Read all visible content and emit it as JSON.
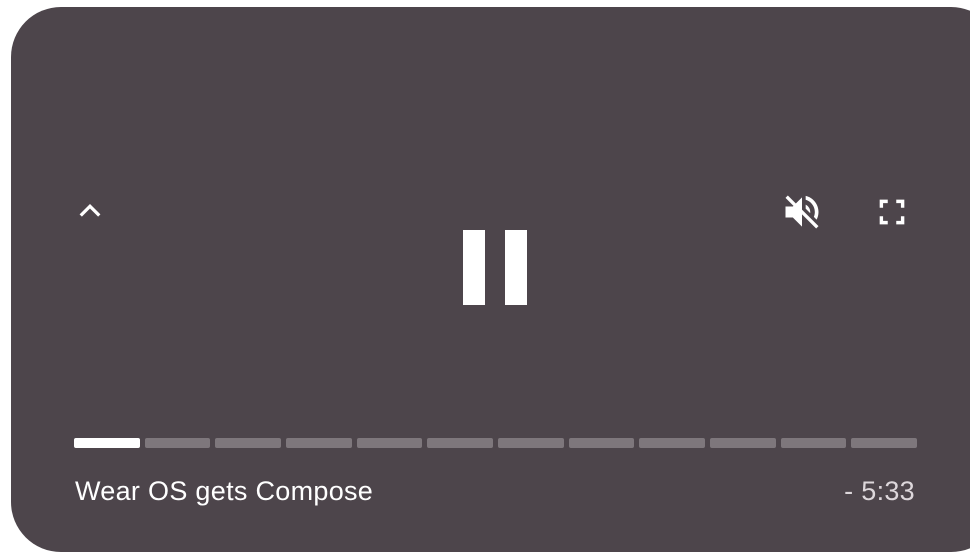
{
  "player": {
    "title": "Wear OS gets Compose",
    "remaining_time": "- 5:33",
    "state": "playing",
    "muted": true,
    "progress_segments": 12,
    "active_segment": 1
  },
  "icons": {
    "collapse": "chevron-up-icon",
    "mute": "volume-off-icon",
    "fullscreen": "fullscreen-icon",
    "pause": "pause-icon"
  },
  "colors": {
    "background": "#4d454b",
    "foreground": "#ffffff",
    "segment_inactive": "#7e777c"
  }
}
